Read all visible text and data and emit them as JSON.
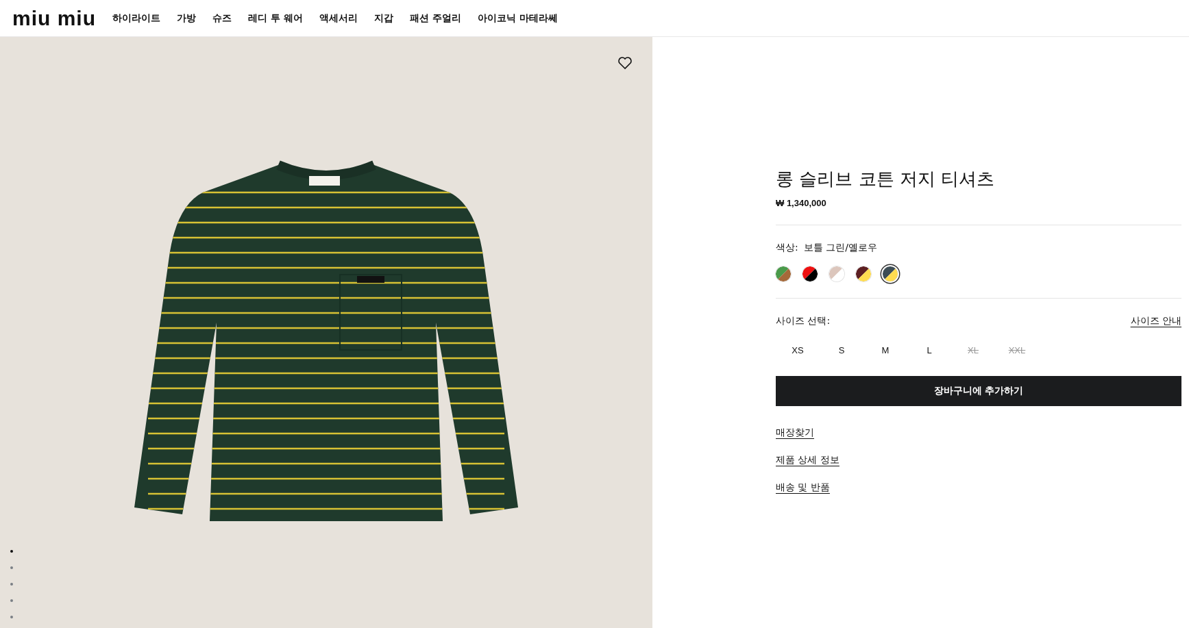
{
  "header": {
    "logo": "miu miu",
    "nav": [
      {
        "label": "하이라이트"
      },
      {
        "label": "가방"
      },
      {
        "label": "슈즈"
      },
      {
        "label": "레디 투 웨어"
      },
      {
        "label": "액세서리"
      },
      {
        "label": "지갑"
      },
      {
        "label": "패션 주얼리"
      },
      {
        "label": "아이코닉 마테라쎄"
      }
    ]
  },
  "gallery": {
    "wishlisted": false,
    "dots": [
      {
        "selected": true
      },
      {
        "selected": false
      },
      {
        "selected": false
      },
      {
        "selected": false
      },
      {
        "selected": false
      }
    ]
  },
  "product": {
    "title": "롱 슬리브 코튼 저지 티셔츠",
    "price": "₩ 1,340,000",
    "color_label": "색상:",
    "color_value": "보틀 그린/옐로우",
    "swatches": [
      {
        "halves": [
          {
            "color": "#4a9a4a"
          },
          {
            "color": "#a5693a"
          }
        ],
        "selected": false
      },
      {
        "halves": [
          {
            "color": "#ee1111"
          },
          {
            "color": "#000000"
          }
        ],
        "selected": false
      },
      {
        "halves": [
          {
            "color": "#dcc6bc"
          },
          {
            "color": "#ffffff"
          }
        ],
        "selected": false
      },
      {
        "halves": [
          {
            "color": "#5c1f22"
          },
          {
            "color": "#ffdc50"
          }
        ],
        "selected": false
      },
      {
        "halves": [
          {
            "color": "#3d4d55"
          },
          {
            "color": "#ffdc50"
          }
        ],
        "selected": true
      }
    ],
    "size_label": "사이즈 선택:",
    "size_guide": "사이즈 안내",
    "sizes": [
      {
        "label": "XS",
        "available": true
      },
      {
        "label": "S",
        "available": true
      },
      {
        "label": "M",
        "available": true
      },
      {
        "label": "L",
        "available": true
      },
      {
        "label": "XL",
        "available": false
      },
      {
        "label": "XXL",
        "available": false
      }
    ],
    "add_to_cart": "장바구니에 추가하기",
    "links": [
      "매장찾기",
      "제품 상세 정보",
      "배송 및 반품"
    ]
  }
}
